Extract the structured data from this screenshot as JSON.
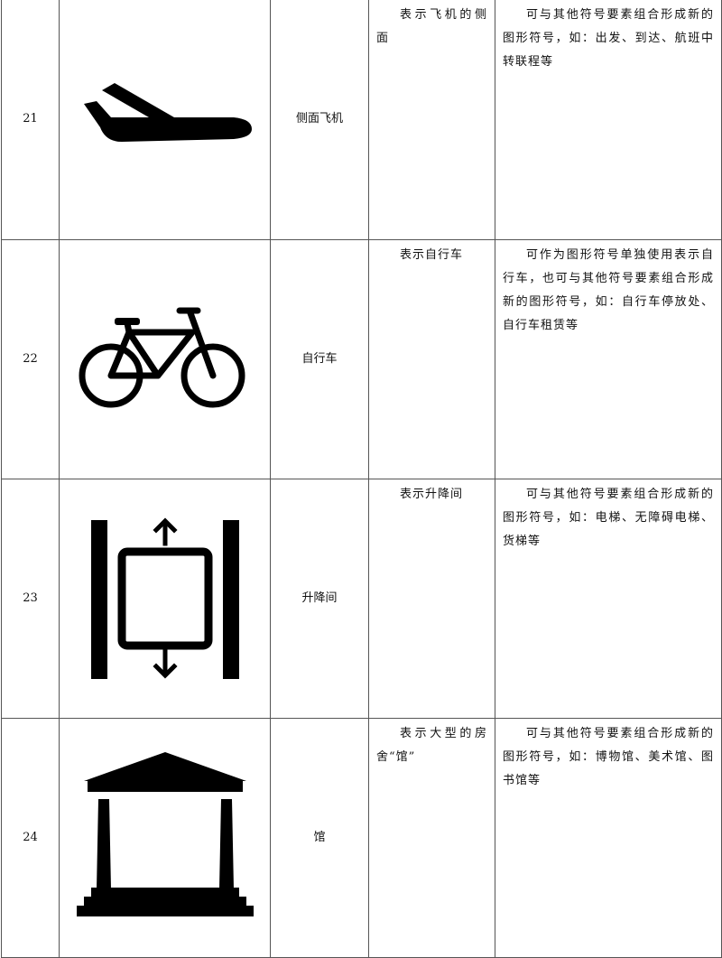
{
  "rows": [
    {
      "number": "21",
      "icon": "airplane-side-icon",
      "name": "侧面飞机",
      "meaning": "表示飞机的侧面",
      "description": "可与其他符号要素组合形成新的图形符号，如：出发、到达、航班中转联程等"
    },
    {
      "number": "22",
      "icon": "bicycle-icon",
      "name": "自行车",
      "meaning": "表示自行车",
      "description": "可作为图形符号单独使用表示自行车，也可与其他符号要素组合形成新的图形符号，如：自行车停放处、自行车租赁等"
    },
    {
      "number": "23",
      "icon": "elevator-icon",
      "name": "升降间",
      "meaning": "表示升降间",
      "description": "可与其他符号要素组合形成新的图形符号，如：电梯、无障碍电梯、货梯等"
    },
    {
      "number": "24",
      "icon": "hall-building-icon",
      "name": "馆",
      "meaning": "表示大型的房舍“馆”",
      "description": "可与其他符号要素组合形成新的图形符号，如：博物馆、美术馆、图书馆等"
    }
  ]
}
